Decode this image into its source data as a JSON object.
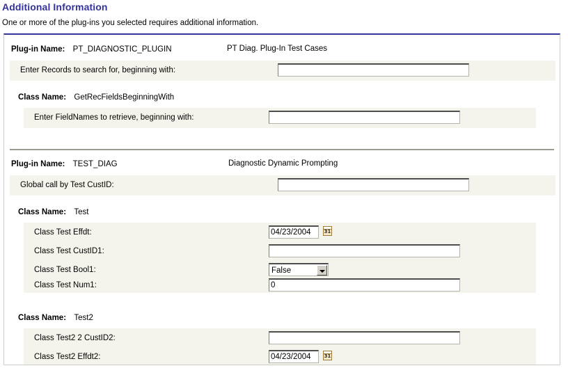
{
  "header": {
    "title": "Additional Information",
    "subtitle": "One or more of the plug-ins you selected requires additional information."
  },
  "labels": {
    "plugin_name": "Plug-in Name:",
    "class_name": "Class Name:"
  },
  "icons": {
    "calendar": "calendar-icon",
    "calendar_day": "31",
    "dropdown": "chevron-down-icon"
  },
  "plugins": [
    {
      "name": "PT_DIAGNOSTIC_PLUGIN",
      "description": "PT Diag. Plug-In Test Cases",
      "fields": [
        {
          "label": "Enter Records to search for, beginning with:",
          "value": "",
          "type": "text"
        }
      ],
      "classes": [
        {
          "name": "GetRecFieldsBeginningWith",
          "fields": [
            {
              "label": "Enter FieldNames to retrieve, beginning with:",
              "value": "",
              "type": "text"
            }
          ]
        }
      ]
    },
    {
      "name": "TEST_DIAG",
      "description": "Diagnostic Dynamic Prompting",
      "fields": [
        {
          "label": "Global call by Test CustID:",
          "value": "",
          "type": "text"
        }
      ],
      "classes": [
        {
          "name": "Test",
          "fields": [
            {
              "label": "Class Test Effdt:",
              "value": "04/23/2004",
              "type": "date"
            },
            {
              "label": "Class Test CustID1:",
              "value": "",
              "type": "text"
            },
            {
              "label": "Class Test Bool1:",
              "value": "False",
              "type": "select"
            },
            {
              "label": "Class Test Num1:",
              "value": "0",
              "type": "text"
            }
          ]
        },
        {
          "name": "Test2",
          "fields": [
            {
              "label": "Class Test2 2 CustID2:",
              "value": "",
              "type": "text"
            },
            {
              "label": "Class Test2 Effdt2:",
              "value": "04/23/2004",
              "type": "date"
            }
          ]
        }
      ]
    }
  ],
  "colors": {
    "title": "#333399",
    "panel_top_border": "#333399",
    "row_shade": "#f5f4ec",
    "divider": "#9a9a92"
  }
}
